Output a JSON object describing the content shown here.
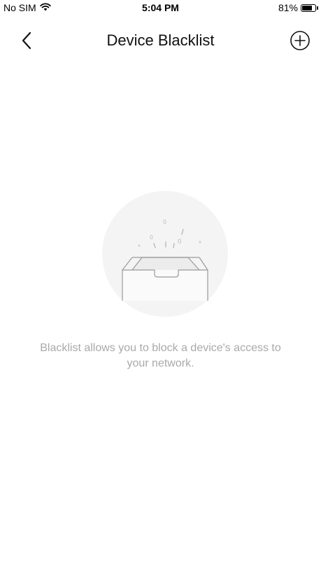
{
  "status_bar": {
    "carrier": "No SIM",
    "time": "5:04 PM",
    "battery_percent": "81%",
    "battery_level": 0.81,
    "wifi_icon": "wifi-icon"
  },
  "nav": {
    "title": "Device Blacklist",
    "back_icon": "chevron-left-icon",
    "add_icon": "plus-circle-icon"
  },
  "empty_state": {
    "illustration": "empty-tray-illustration",
    "message": "Blacklist allows you to block a device's access to your network."
  },
  "colors": {
    "background": "#ffffff",
    "illustration_circle": "#f4f4f4",
    "muted_text": "#a9a9a9",
    "title_text": "#111111"
  }
}
